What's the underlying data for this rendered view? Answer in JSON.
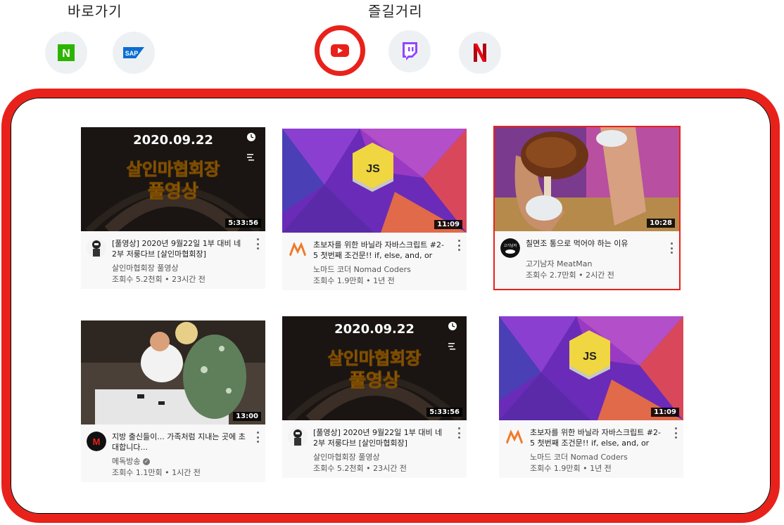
{
  "shortcuts": {
    "label": "바로가기",
    "items": [
      {
        "name": "Naver",
        "glyph": "N",
        "color": "#2db400"
      },
      {
        "name": "SAP",
        "glyph": "SAP",
        "color": "#0a6ed1"
      }
    ]
  },
  "favorites": {
    "label": "즐길거리",
    "items": [
      {
        "name": "YouTube",
        "color": "#e8221a",
        "selected": true
      },
      {
        "name": "Twitch",
        "color": "#9146ff"
      },
      {
        "name": "Netflix",
        "glyph": "N",
        "color": "#e50914"
      }
    ]
  },
  "colors": {
    "accent": "#e8221a"
  },
  "videos": [
    {
      "thumb_date": "2020.09.22",
      "thumb_line1": "살인마협회장",
      "thumb_line2": "풀영상",
      "duration": "5:33:56",
      "title": "[풀영상] 2020년 9월22일 1부 대비 네 2부 저룽다브 [살인마협회장]",
      "channel": "살인마협회장 풀영상",
      "stats": "조회수 5.2천회 • 23시간 전"
    },
    {
      "thumb_badge": "JS",
      "duration": "11:09",
      "title": "초보자를 위한 바닐라 자바스크립트 #2-5 첫번째 조건문!! if, else, and, or",
      "channel": "노마드 코더 Nomad Coders",
      "stats": "조회수 1.9만회 • 1년 전"
    },
    {
      "duration": "10:28",
      "title": "칠면조 통으로 먹어야 하는 이유",
      "channel": "고기남자 MeatMan",
      "stats": "조회수 2.7만회 • 2시간 전",
      "avatar_text": "고기남자"
    },
    {
      "duration": "13:00",
      "title": "지방 출신들이... 가족처럼 지내는 곳에 초대합니다...",
      "channel": "메독방송",
      "stats": "조회수 1.1만회 • 1시간 전",
      "avatar_text": "M"
    },
    {
      "thumb_date": "2020.09.22",
      "thumb_line1": "살인마협회장",
      "thumb_line2": "풀영상",
      "duration": "5:33:56",
      "title": "[풀영상] 2020년 9월22일 1부 대비 네 2부 저룽다브 [살인마협회장]",
      "channel": "살인마협회장 풀영상",
      "stats": "조회수 5.2천회 • 23시간 전"
    },
    {
      "thumb_badge": "JS",
      "duration": "11:09",
      "title": "초보자를 위한 바닐라 자바스크립트 #2-5 첫번째 조건문!! if, else, and, or",
      "channel": "노마드 코더 Nomad Coders",
      "stats": "조회수 1.9만회 • 1년 전"
    }
  ]
}
